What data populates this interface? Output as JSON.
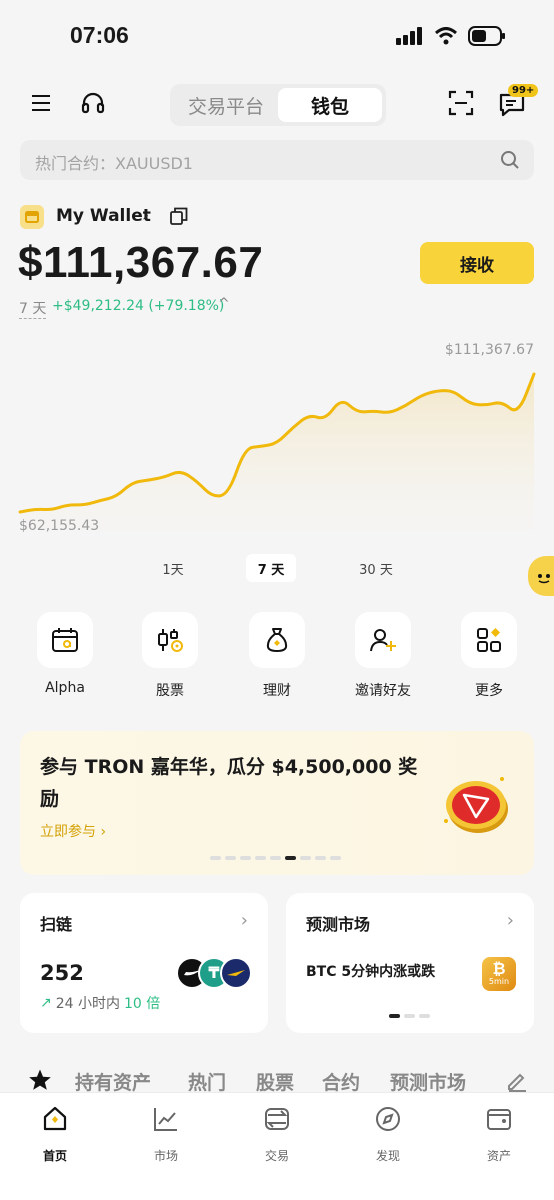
{
  "status": {
    "time": "07:06"
  },
  "header": {
    "tabs": [
      {
        "label": "交易平台"
      },
      {
        "label": "钱包"
      }
    ],
    "badge": "99+"
  },
  "search": {
    "placeholder": "热门合约：XAUUSD1"
  },
  "wallet": {
    "name": "My Wallet",
    "balance": "$111,367.67",
    "receive_label": "接收",
    "period": "7 天",
    "change": "+$49,212.24 (+79.18%)"
  },
  "chart_data": {
    "type": "area",
    "high_label": "$111,367.67",
    "low_label": "$62,155.43",
    "ylim": [
      62155.43,
      111367.67
    ],
    "color": "#f0b90b",
    "values": [
      62155,
      63200,
      62900,
      64800,
      64600,
      66300,
      67600,
      72800,
      73500,
      74600,
      77000,
      73200,
      67400,
      68600,
      85000,
      85500,
      86600,
      92400,
      96900,
      95000,
      102800,
      97600,
      98200,
      97400,
      100000,
      103800,
      105500,
      105400,
      100700,
      100200,
      101600,
      96800,
      111368
    ]
  },
  "ranges": [
    {
      "label": "1天"
    },
    {
      "label": "7 天"
    },
    {
      "label": "30 天"
    }
  ],
  "actions": [
    {
      "label": "Alpha",
      "icon": "alpha-calendar-icon"
    },
    {
      "label": "股票",
      "icon": "stocks-candles-icon"
    },
    {
      "label": "理财",
      "icon": "money-bag-icon"
    },
    {
      "label": "邀请好友",
      "icon": "invite-friend-icon"
    },
    {
      "label": "更多",
      "icon": "more-grid-icon"
    }
  ],
  "banner": {
    "title": "参与 TRON 嘉年华，瓜分 $4,500,000 奖励",
    "link": "立即参与 ›"
  },
  "cards": {
    "scan": {
      "title": "扫链",
      "value": "252",
      "sub_prefix": "24 小时内",
      "sub_value": "10 倍"
    },
    "predict": {
      "title": "预测市场",
      "text": "BTC 5分钟内涨或跌",
      "badge": "5min"
    }
  },
  "asset_tabs": [
    {
      "label": "持有资产"
    },
    {
      "label": "热门"
    },
    {
      "label": "股票"
    },
    {
      "label": "合约"
    },
    {
      "label": "预测市场"
    }
  ],
  "nav": [
    {
      "label": "首页"
    },
    {
      "label": "市场"
    },
    {
      "label": "交易"
    },
    {
      "label": "发现"
    },
    {
      "label": "资产"
    }
  ]
}
